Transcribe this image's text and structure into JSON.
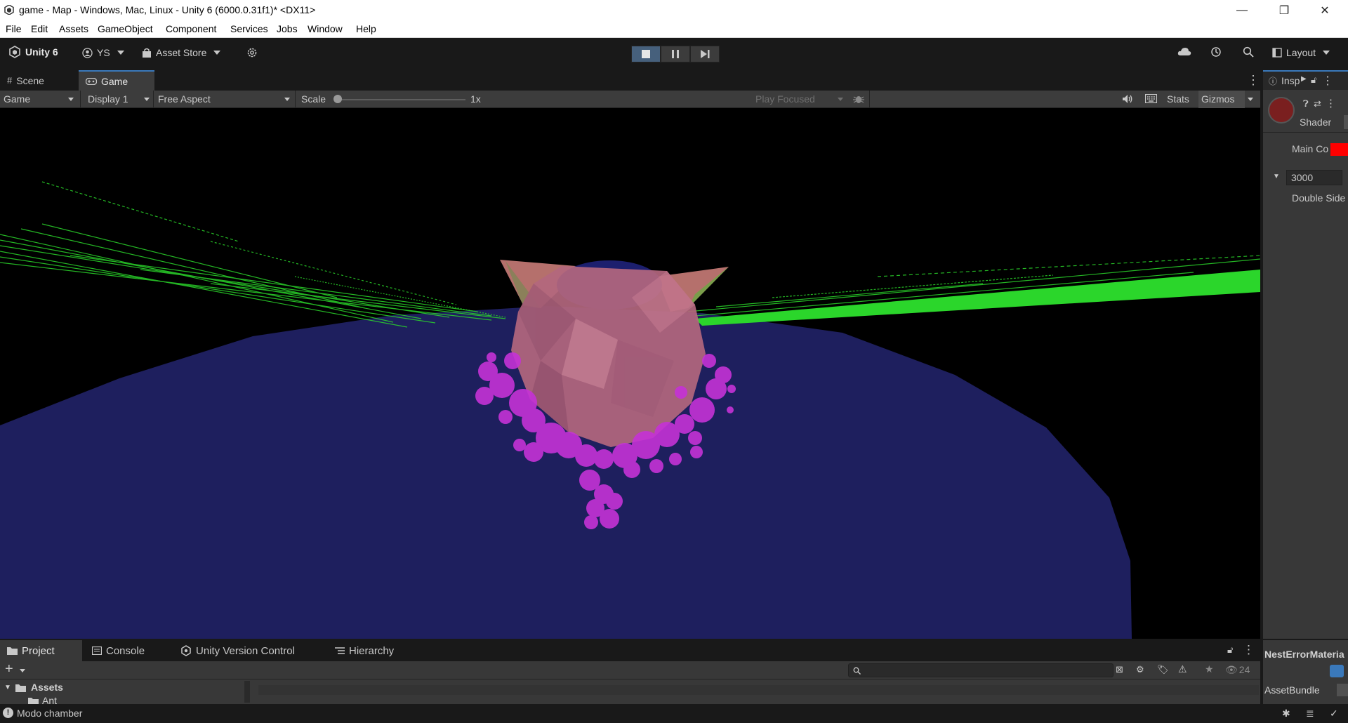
{
  "window": {
    "title": "game - Map - Windows, Mac, Linux - Unity 6 (6000.0.31f1)* <DX11>",
    "minimize": "—",
    "restore": "❐",
    "close": "✕"
  },
  "menu": [
    "File",
    "Edit",
    "Assets",
    "GameObject",
    "Component",
    "Services",
    "Jobs",
    "Window",
    "Help"
  ],
  "toolbar": {
    "unity_label": "Unity 6",
    "account": "YS",
    "asset_store": "Asset Store",
    "layout": "Layout"
  },
  "tabs": {
    "scene": "Scene",
    "game": "Game"
  },
  "game_toolbar": {
    "view_mode": "Game",
    "display": "Display 1",
    "aspect": "Free Aspect",
    "scale_label": "Scale",
    "scale_value": "1x",
    "play_focused": "Play Focused",
    "stats": "Stats",
    "gizmos": "Gizmos"
  },
  "inspector": {
    "tab_label": "Insp",
    "shader_label": "Shader",
    "main_color_label": "Main Co",
    "main_color": "#ff0000",
    "render_queue": "3000",
    "double_sided_label": "Double Side"
  },
  "bottom_tabs": {
    "project": "Project",
    "console": "Console",
    "version_control": "Unity Version Control",
    "hierarchy": "Hierarchy"
  },
  "project": {
    "hidden_count": "24",
    "assets_label": "Assets",
    "first_folder": "Ant"
  },
  "right_bottom": {
    "material_name": "NestErrorMateria",
    "asset_bundle_label": "AssetBundle"
  },
  "status": {
    "message": "Modo chamber"
  },
  "colors": {
    "accent": "#3a79bb",
    "ground": "#1e1f5e",
    "green_lines": "#2bd62b",
    "particles": "#c532d6",
    "sphere": "#b3677e"
  }
}
